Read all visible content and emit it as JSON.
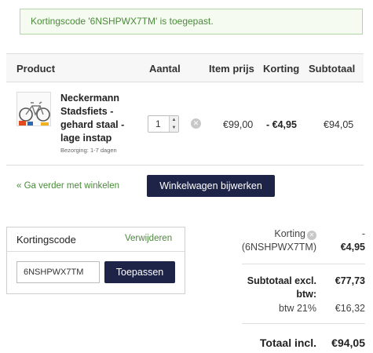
{
  "alert": {
    "text": "Kortingscode '6NSHPWX7TM' is toegepast."
  },
  "cart": {
    "headers": {
      "product": "Product",
      "quantity": "Aantal",
      "item_price": "Item prijs",
      "discount": "Korting",
      "subtotal": "Subtotaal"
    },
    "items": [
      {
        "name": "Neckermann Stadsfiets - gehard staal - lage instap",
        "delivery": "Bezorging: 1-7 dagen",
        "quantity": "1",
        "item_price": "€99,00",
        "discount": "- €4,95",
        "subtotal": "€94,05"
      }
    ],
    "continue_link": "« Ga verder met winkelen",
    "update_button": "Winkelwagen bijwerken"
  },
  "coupon": {
    "title": "Kortingscode",
    "remove_link": "Verwijderen",
    "input_value": "6NSHPWX7TM",
    "apply_button": "Toepassen"
  },
  "totals": {
    "discount_label": "Korting",
    "discount_code": "(6NSHPWX7TM)",
    "discount_dash": "-",
    "discount_value": "€4,95",
    "subtotal_label_1": "Subtotaal excl.",
    "subtotal_label_2": "btw:",
    "subtotal_value": "€77,73",
    "vat_label": "btw 21%",
    "vat_value": "€16,32",
    "total_label": "Totaal incl.",
    "total_value": "€94,05"
  },
  "colors": {
    "accent": "#4a8a3a",
    "button": "#1e2448"
  }
}
